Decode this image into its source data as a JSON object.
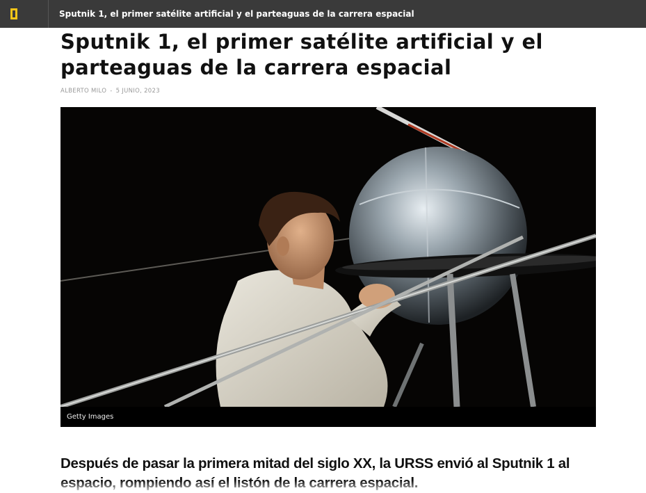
{
  "header": {
    "logo_icon": "national-geographic-yellow-border-icon",
    "logo_color": "#f5c518",
    "title": "Sputnik 1, el primer satélite artificial y el parteaguas de la carrera espacial"
  },
  "article": {
    "headline": "Sputnik 1, el primer satélite artificial y el parteaguas de la carrera espacial",
    "author": "ALBERTO MILO",
    "separator": "-",
    "date": "5 JUNIO, 2023",
    "image_credit": "Getty Images",
    "lede": "Después de pasar la primera mitad del siglo XX, la URSS envió al Sputnik 1 al espacio, rompiendo así el listón de la carrera espacial."
  }
}
